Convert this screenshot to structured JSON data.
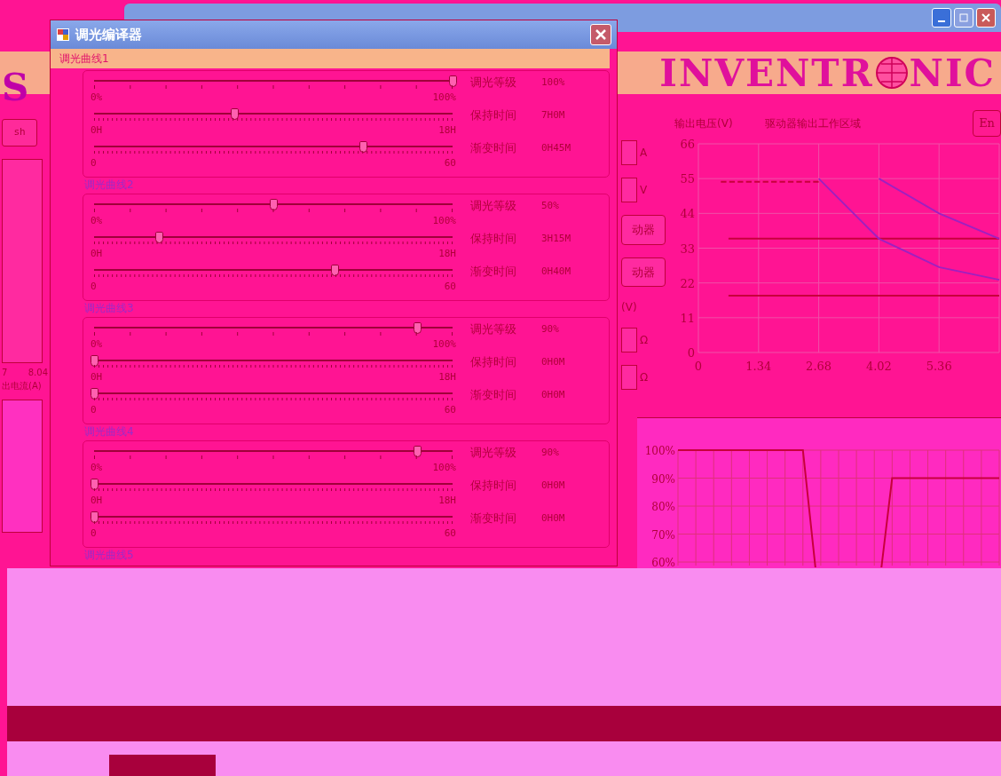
{
  "main_window": {
    "logo": {
      "left": "INVENTR",
      "right": "NIC"
    },
    "left_panel": {
      "big_letter": "S",
      "button": "sh",
      "axis_labels": [
        "7",
        "8.04"
      ],
      "axis_title": "出电流(A)"
    },
    "controls": {
      "current_unit": "A",
      "voltage_unit": "V",
      "buttons": [
        "动器",
        "动器"
      ],
      "unit_label": "(V)",
      "ohm_units": [
        "Ω",
        "Ω"
      ]
    },
    "work_area": {
      "button": "En",
      "chart_data": {
        "type": "line",
        "title": "驱动器输出工作区域",
        "ylabel": "输出电压(V)",
        "grid": true,
        "x": [
          0.5,
          0.67,
          1.34,
          2.68,
          4.02,
          5.36,
          6.7
        ],
        "xlim": [
          0,
          6.7
        ],
        "xticks": [
          0,
          1.34,
          2.68,
          4.02,
          5.36
        ],
        "yticks": [
          0,
          11,
          22,
          33,
          44,
          55,
          66
        ],
        "ylim": [
          0,
          66
        ],
        "series": [
          {
            "color": "#c8003c",
            "line_style": "dashed",
            "values": [
              54,
              54,
              54,
              54,
              null,
              null,
              null
            ]
          },
          {
            "color": "#c8003c",
            "values": [
              null,
              36,
              36,
              36,
              36,
              36,
              36
            ]
          },
          {
            "color": "#c8003c",
            "values": [
              null,
              18,
              18,
              18,
              18,
              18,
              18
            ]
          },
          {
            "color": "#a020c0",
            "values": [
              null,
              null,
              null,
              55,
              36,
              27,
              23
            ]
          },
          {
            "color": "#a020c0",
            "values": [
              null,
              null,
              null,
              null,
              55,
              44,
              36
            ]
          }
        ]
      }
    },
    "profile": {
      "y_labels": [
        "100%",
        "90%",
        "80%",
        "70%",
        "60%"
      ]
    }
  },
  "dialog": {
    "title": "调光编译器",
    "curves": [
      {
        "title": "调光曲线1",
        "selected": true,
        "sliders": [
          {
            "kind": "sparse",
            "label": "调光等级",
            "reading": "100%",
            "level": 1,
            "min": "0%",
            "max": "100%"
          },
          {
            "kind": "dense",
            "label": "保持时间",
            "reading": "7H0M",
            "level": 0.39,
            "min": "0H",
            "max": "18H"
          },
          {
            "kind": "dense",
            "label": "渐变时间",
            "reading": "0H45M",
            "level": 0.75,
            "min": "0",
            "max": "60"
          }
        ]
      },
      {
        "title": "调光曲线2",
        "selected": false,
        "sliders": [
          {
            "kind": "sparse",
            "label": "调光等级",
            "reading": "50%",
            "level": 0.5,
            "min": "0%",
            "max": "100%"
          },
          {
            "kind": "dense",
            "label": "保持时间",
            "reading": "3H15M",
            "level": 0.18,
            "min": "0H",
            "max": "18H"
          },
          {
            "kind": "dense",
            "label": "渐变时间",
            "reading": "0H40M",
            "level": 0.67,
            "min": "0",
            "max": "60"
          }
        ]
      },
      {
        "title": "调光曲线3",
        "selected": false,
        "sliders": [
          {
            "kind": "sparse",
            "label": "调光等级",
            "reading": "90%",
            "level": 0.9,
            "min": "0%",
            "max": "100%"
          },
          {
            "kind": "dense",
            "label": "保持时间",
            "reading": "0H0M",
            "level": 0,
            "min": "0H",
            "max": "18H"
          },
          {
            "kind": "dense",
            "label": "渐变时间",
            "reading": "0H0M",
            "level": 0,
            "min": "0",
            "max": "60"
          }
        ]
      },
      {
        "title": "调光曲线4",
        "selected": false,
        "sliders": [
          {
            "kind": "sparse",
            "label": "调光等级",
            "reading": "90%",
            "level": 0.9,
            "min": "0%",
            "max": "100%"
          },
          {
            "kind": "dense",
            "label": "保持时间",
            "reading": "0H0M",
            "level": 0,
            "min": "0H",
            "max": "18H"
          },
          {
            "kind": "dense",
            "label": "渐变时间",
            "reading": "0H0M",
            "level": 0,
            "min": "0",
            "max": "60"
          }
        ]
      }
    ],
    "partial_curve": "调光曲线5"
  }
}
